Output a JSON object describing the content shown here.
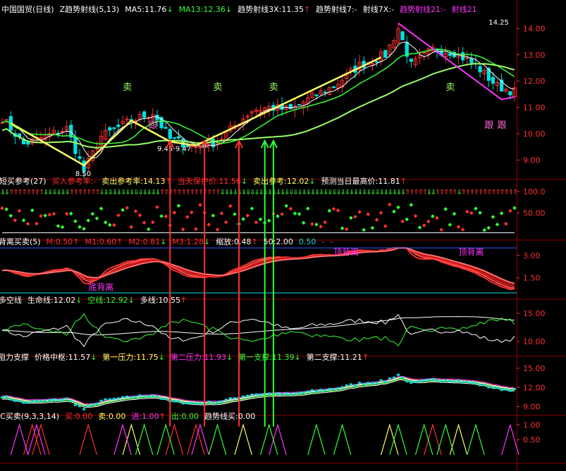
{
  "colors": {
    "bg": "#000000",
    "border": "#8a0000",
    "grid": "#8a0000",
    "up": "#ff3030",
    "down": "#00e0e0",
    "yellow": "#ffff66",
    "green": "#33ff33",
    "lightgreen": "#99ff66",
    "white": "#ffffff",
    "magenta": "#ff33ff",
    "orange": "#ff8800",
    "blue": "#3355ff",
    "pink": "#ff66cc"
  },
  "panel1": {
    "items": [
      {
        "text": "中国国贸(日线)",
        "color": "#ffffff"
      },
      {
        "text": "Z趋势射线(5,13)",
        "color": "#ffffff"
      },
      {
        "text": "MA5:11.76",
        "color": "#ffffff",
        "arrow": "↓",
        "arrow_color": "#33ff33"
      },
      {
        "text": "MA13:12.36",
        "color": "#33ff33",
        "arrow": "↓",
        "arrow_color": "#33ff33"
      },
      {
        "text": "趋势射线3X:11.35",
        "color": "#ffffff",
        "arrow": "↑",
        "arrow_color": "#ff3030"
      },
      {
        "text": "趋势射线7:-",
        "color": "#ffffff"
      },
      {
        "text": "射线7X:-",
        "color": "#ffffff"
      },
      {
        "text": "趋势射线21:-",
        "color": "#ff33ff"
      },
      {
        "text": "射线21",
        "color": "#ff33ff"
      }
    ],
    "annotations": [
      {
        "text": "卖",
        "x": 86,
        "color": "#99ff66"
      },
      {
        "text": "卖",
        "x": 52,
        "color": "#99ff66"
      },
      {
        "text": "卖",
        "x": 23,
        "color": "#99ff66"
      },
      {
        "text": "卖",
        "x": 41,
        "color": "#99ff66"
      },
      {
        "text": "跟",
        "x": 28,
        "color": "#ff66cc"
      },
      {
        "text": "跟",
        "x": 96,
        "color": "#ff66cc"
      },
      {
        "text": "跟",
        "x": 93,
        "color": "#ff66cc"
      }
    ],
    "price_labels": [
      {
        "text": "14.25",
        "x": 94,
        "y": 14.25
      },
      {
        "text": "8.50",
        "x": 14,
        "y": 8.5
      },
      {
        "text": "9.45-9.47",
        "x": 30,
        "y": 9.45
      }
    ]
  },
  "panel2": {
    "items": [
      {
        "text": "短买参考(27)",
        "color": "#ffffff"
      },
      {
        "text": "买入参考率:-",
        "color": "#ff3030"
      },
      {
        "text": "卖出参考率:14.13",
        "color": "#ffff66",
        "arrow": "↑",
        "arrow_color": "#ff3030"
      },
      {
        "text": "当天保护价:11.56",
        "color": "#ff3030",
        "arrow": "↓",
        "arrow_color": "#33ff33"
      },
      {
        "text": "卖出参考:12.02",
        "color": "#ffff66",
        "arrow": "↓",
        "arrow_color": "#33ff33"
      },
      {
        "text": "预测当日最高价:11.81",
        "color": "#ffffff",
        "arrow": "↑",
        "arrow_color": "#ff3030"
      }
    ]
  },
  "panel3": {
    "items": [
      {
        "text": "背离买卖(5)",
        "color": "#ffffff"
      },
      {
        "text": "M:0.50",
        "color": "#ff3030",
        "arrow": "↑",
        "arrow_color": "#ff3030"
      },
      {
        "text": "M1:0.60",
        "color": "#ff3030",
        "arrow": "↑",
        "arrow_color": "#ff3030"
      },
      {
        "text": "M2:0.81",
        "color": "#ff3030",
        "arrow": "↓",
        "arrow_color": "#33ff33"
      },
      {
        "text": "M3:1.28",
        "color": "#ff3030",
        "arrow": "↓",
        "arrow_color": "#33ff33"
      },
      {
        "text": "缩放:0.48",
        "color": "#ffffff",
        "arrow": "↑",
        "arrow_color": "#ff3030"
      },
      {
        "text": "50:2.00",
        "color": "#ffffff"
      },
      {
        "text": "0.50",
        "color": "#00e0e0"
      },
      {
        "text": "-",
        "color": "#ff33ff"
      },
      {
        "text": "-",
        "color": "#ff33ff"
      }
    ],
    "annotations": [
      {
        "text": "顶背离",
        "x": 64,
        "color": "#ff33ff"
      },
      {
        "text": "顶背离",
        "x": 88,
        "color": "#ff33ff"
      },
      {
        "text": "底背离",
        "x": 17,
        "color": "#ff33ff"
      }
    ]
  },
  "panel4": {
    "items": [
      {
        "text": "多空线",
        "color": "#ffffff"
      },
      {
        "text": "生命线:12.02",
        "color": "#ffffff",
        "arrow": "↓",
        "arrow_color": "#33ff33"
      },
      {
        "text": "空线:12.92",
        "color": "#33ff33",
        "arrow": "↓",
        "arrow_color": "#33ff33"
      },
      {
        "text": "多线:10.55",
        "color": "#ffffff",
        "arrow": "↑",
        "arrow_color": "#ff3030"
      }
    ]
  },
  "panel5": {
    "items": [
      {
        "text": "阻力支撑",
        "color": "#ffffff"
      },
      {
        "text": "价格中枢:11.57",
        "color": "#ffffff",
        "arrow": "↓",
        "arrow_color": "#33ff33"
      },
      {
        "text": "第一压力:11.75",
        "color": "#ffff66",
        "arrow": "↓",
        "arrow_color": "#33ff33"
      },
      {
        "text": "第二压力:11.93",
        "color": "#ff33ff",
        "arrow": "↓",
        "arrow_color": "#33ff33"
      },
      {
        "text": "第一支撑:11.39",
        "color": "#33ff33",
        "arrow": "↓",
        "arrow_color": "#33ff33"
      },
      {
        "text": "第二支撑:11.21",
        "color": "#ffffff",
        "arrow": "↑",
        "arrow_color": "#ff3030"
      }
    ]
  },
  "panel6": {
    "items": [
      {
        "text": "JC买卖(9,3,3,14)",
        "color": "#ffffff"
      },
      {
        "text": "买:0.00",
        "color": "#ff3030"
      },
      {
        "text": "卖:0.00",
        "color": "#ffff66"
      },
      {
        "text": "进:1.00",
        "color": "#ff33ff",
        "arrow": "↑",
        "arrow_color": "#ff3030"
      },
      {
        "text": "出:0.00",
        "color": "#33ff33"
      },
      {
        "text": "趋势线买:0.00",
        "color": "#ffffff"
      }
    ]
  },
  "chart_data": {
    "type": "candlestick",
    "n_bars": 120,
    "x": "bar index 0-119",
    "panels": [
      {
        "name": "price",
        "ylim": [
          8.5,
          14.6
        ],
        "ticks": [
          9.0,
          10.0,
          11.0,
          12.0,
          13.0,
          14.0
        ],
        "tick_labels": [
          "9.00",
          "10.00",
          "11.00",
          "12.00",
          "13.00",
          "14.00"
        ],
        "close_keypoints": [
          [
            0,
            10.6
          ],
          [
            5,
            9.6
          ],
          [
            10,
            9.9
          ],
          [
            15,
            10.2
          ],
          [
            19,
            8.6
          ],
          [
            23,
            9.9
          ],
          [
            30,
            10.5
          ],
          [
            35,
            10.8
          ],
          [
            39,
            9.8
          ],
          [
            45,
            9.5
          ],
          [
            50,
            9.7
          ],
          [
            58,
            10.9
          ],
          [
            62,
            11.0
          ],
          [
            67,
            10.9
          ],
          [
            72,
            11.4
          ],
          [
            77,
            11.8
          ],
          [
            83,
            12.6
          ],
          [
            89,
            13.0
          ],
          [
            92,
            14.0
          ],
          [
            95,
            12.6
          ],
          [
            100,
            13.2
          ],
          [
            105,
            13.1
          ],
          [
            110,
            12.6
          ],
          [
            115,
            11.8
          ],
          [
            119,
            11.6
          ]
        ],
        "ma5": 11.76,
        "ma13": 12.36
      },
      {
        "name": "short_buy_ref",
        "ylim": [
          0,
          115
        ],
        "ticks": [
          50.0,
          100.0
        ],
        "tick_labels": [
          "50.00",
          "100.0"
        ]
      },
      {
        "name": "divergence",
        "ylim": [
          0.5,
          3.6
        ],
        "ticks": [
          1.5,
          3.0
        ],
        "tick_labels": [
          "1.50",
          "3.00"
        ]
      },
      {
        "name": "bull_bear",
        "ylim": [
          8.5,
          16.5
        ],
        "ticks": [
          10.0,
          15.0
        ],
        "tick_labels": [
          "10.00",
          "15.00"
        ]
      },
      {
        "name": "resistance_support",
        "ylim": [
          8.5,
          16.0
        ],
        "ticks": [
          9.0,
          12.0,
          15.0
        ],
        "tick_labels": [
          "9.00",
          "12.00",
          "15.00"
        ]
      },
      {
        "name": "jc_signal",
        "ylim": [
          0,
          1.15
        ],
        "ticks": [
          0.5,
          1.0
        ],
        "tick_labels": [
          "0.50",
          "1.00"
        ],
        "buy": [
          7,
          9,
          20,
          40,
          45,
          100
        ],
        "sell": [
          30,
          56,
          90,
          106
        ],
        "enter": [
          4,
          8,
          28,
          46,
          64,
          118
        ],
        "exit": [
          33,
          38,
          50,
          62,
          73,
          79,
          92,
          98,
          103,
          110
        ]
      }
    ],
    "signal_lines": [
      {
        "bar": 39,
        "color": "#ff3030"
      },
      {
        "bar": 47,
        "color": "#ff3030"
      },
      {
        "bar": 55,
        "color": "#ff3030"
      },
      {
        "bar": 61,
        "color": "#33ff33"
      },
      {
        "bar": 63,
        "color": "#33ff33"
      }
    ]
  }
}
